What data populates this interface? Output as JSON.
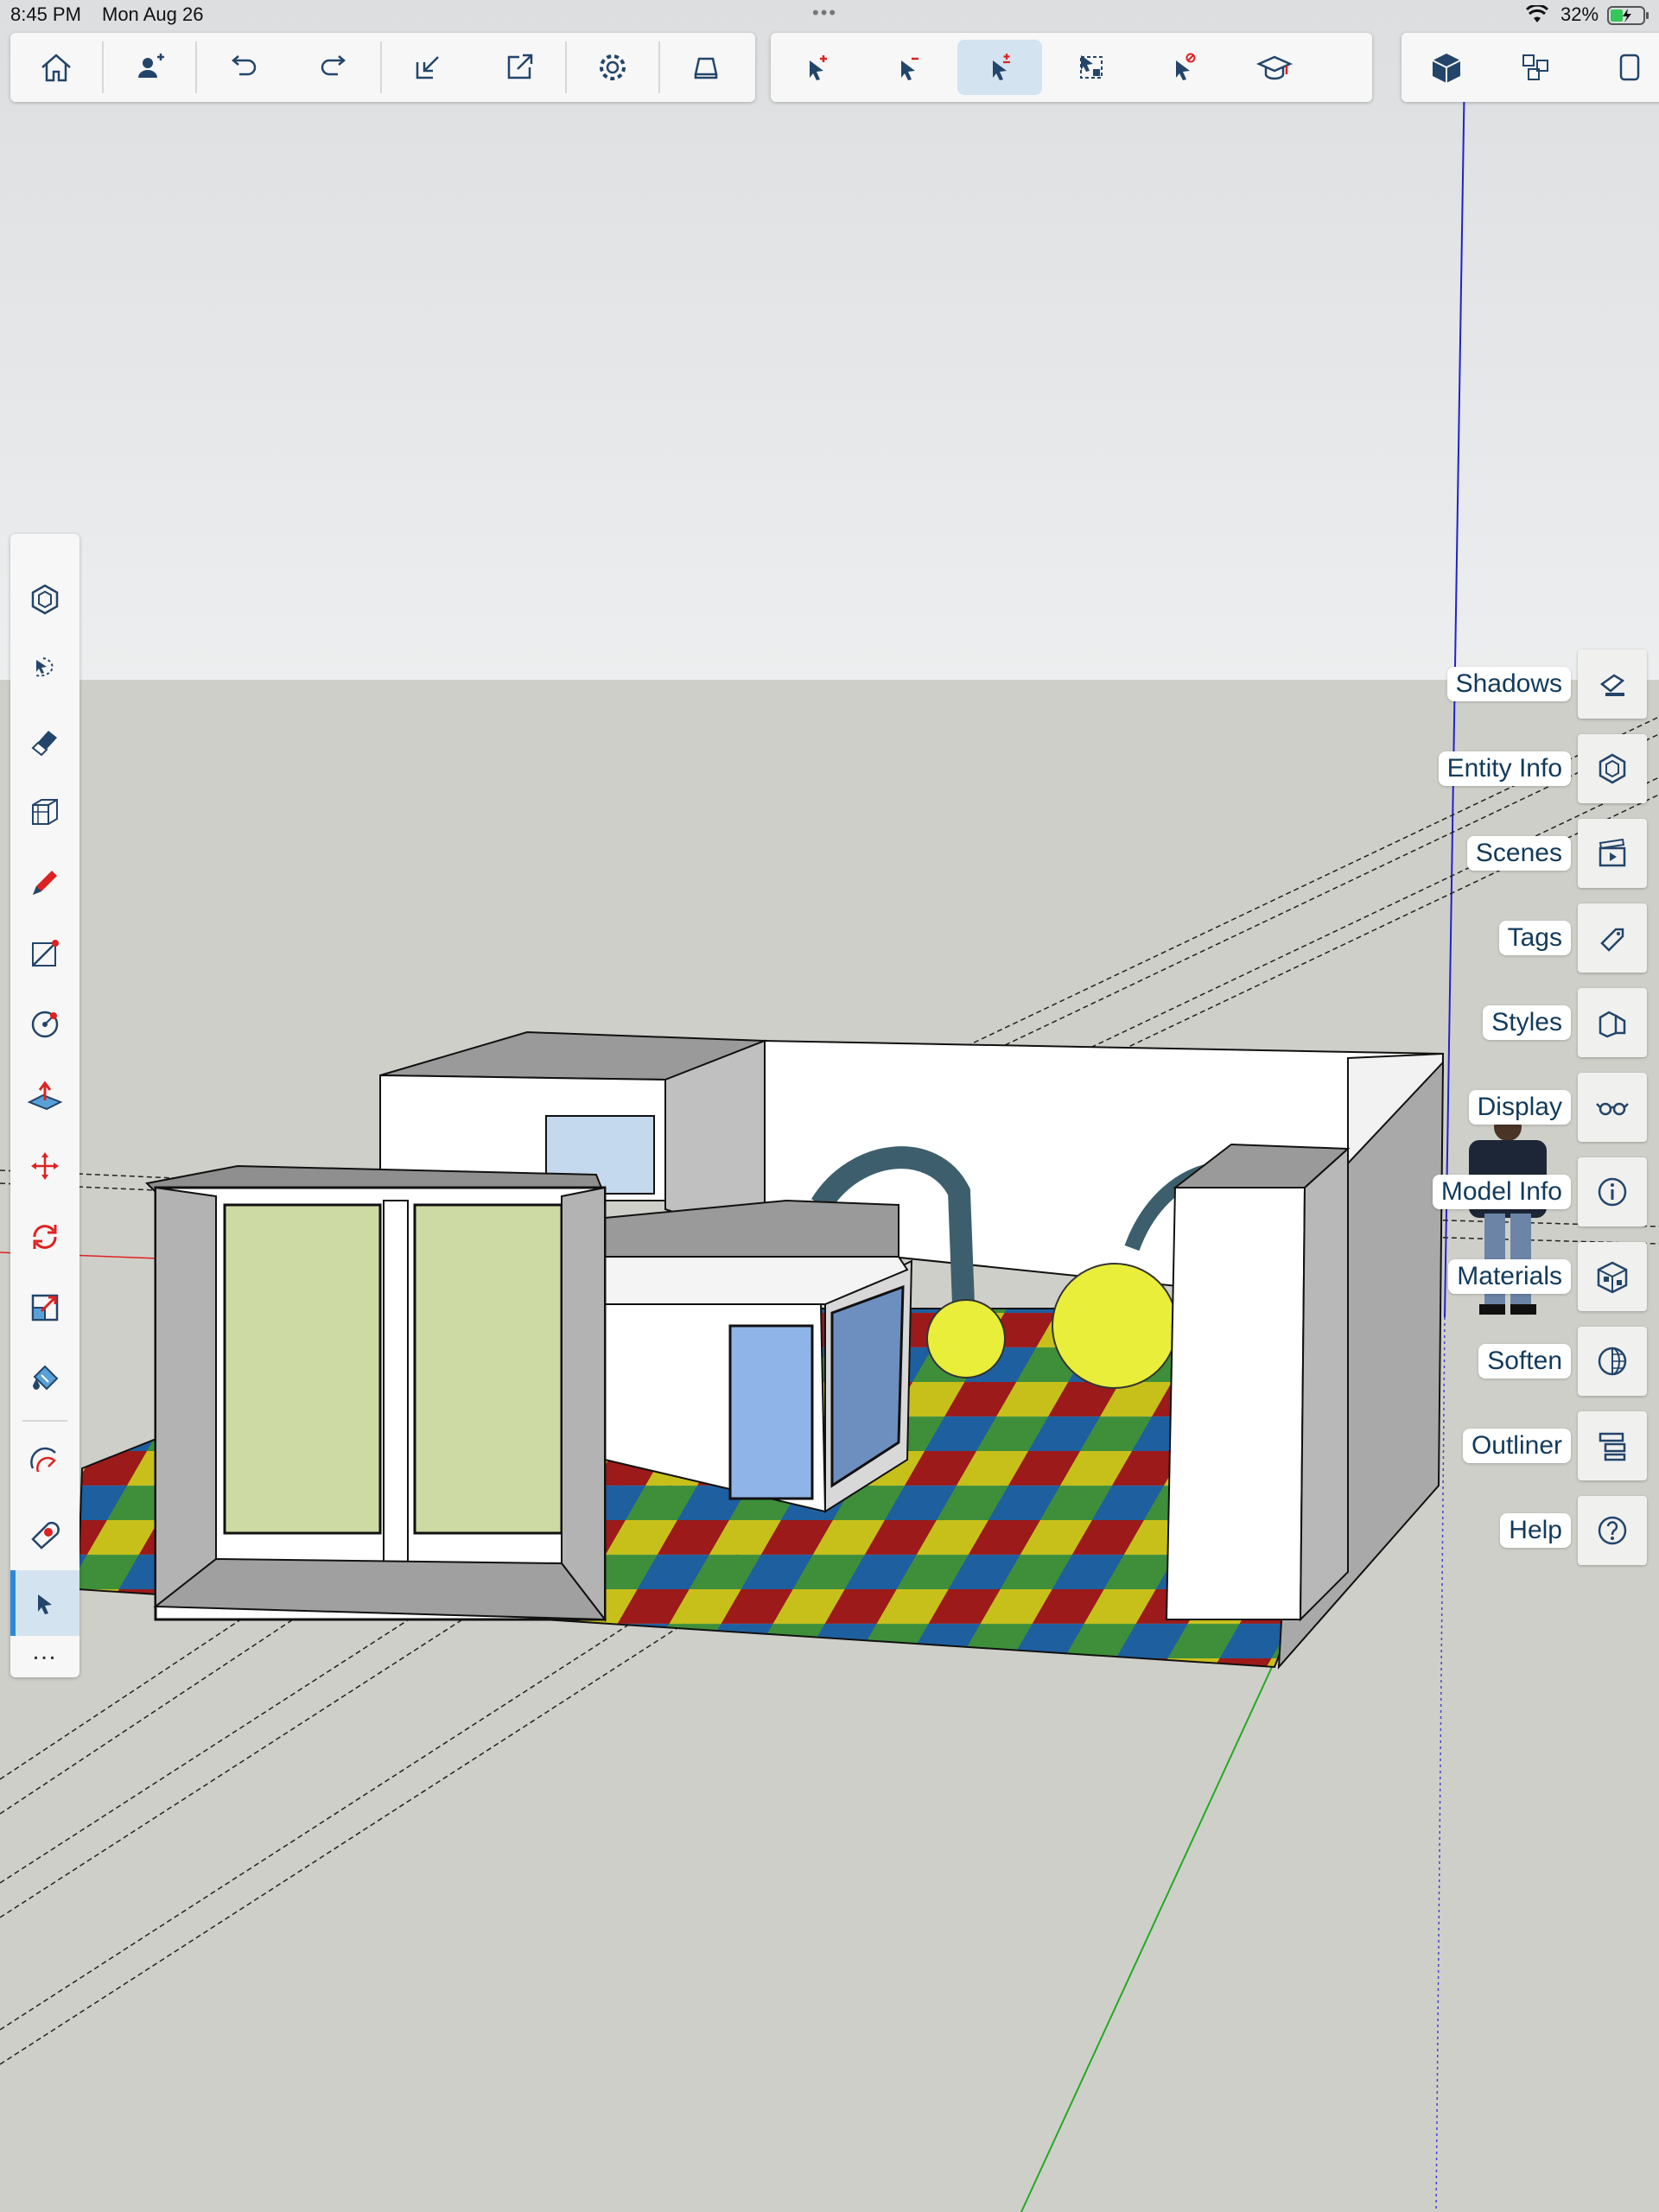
{
  "status_bar": {
    "time": "8:45 PM",
    "date": "Mon Aug 26",
    "multitask_dots": "•••",
    "battery_percent": "32%"
  },
  "top_toolbar": {
    "groups": [
      [
        "home-icon",
        "add-collaborator-icon",
        "undo-icon",
        "redo-icon",
        "import-icon",
        "export-icon",
        "settings-icon",
        "view-icon"
      ],
      [
        "select-add-icon",
        "select-subtract-icon",
        "select-toggle-icon",
        "select-grid-icon",
        "select-none-icon",
        "learn-icon"
      ],
      [
        "3d-warehouse-icon",
        "components-icon",
        "more-icon"
      ]
    ],
    "active_tool": "select-toggle-icon"
  },
  "left_toolbar": {
    "tools": [
      "orbit-icon",
      "lasso-select-icon",
      "eraser-icon",
      "box-icon",
      "pencil-icon",
      "line-icon",
      "circle-icon",
      "push-pull-icon",
      "move-icon",
      "rotate-icon",
      "scale-icon",
      "paint-icon",
      "offset-icon",
      "tape-measure-icon",
      "select-icon"
    ],
    "active_tool": "select-icon",
    "more_label": "…"
  },
  "right_panel": {
    "items": [
      {
        "label": "Shadows",
        "icon": "shadows-icon"
      },
      {
        "label": "Entity Info",
        "icon": "entity-info-icon"
      },
      {
        "label": "Scenes",
        "icon": "scenes-icon"
      },
      {
        "label": "Tags",
        "icon": "tags-icon"
      },
      {
        "label": "Styles",
        "icon": "styles-icon"
      },
      {
        "label": "Display",
        "icon": "display-icon"
      },
      {
        "label": "Model Info",
        "icon": "model-info-icon"
      },
      {
        "label": "Materials",
        "icon": "materials-icon"
      },
      {
        "label": "Soften",
        "icon": "soften-icon"
      },
      {
        "label": "Outliner",
        "icon": "outliner-icon"
      },
      {
        "label": "Help",
        "icon": "help-icon"
      }
    ]
  },
  "colors": {
    "icon": "#23456a",
    "accent": "#2b8ad8",
    "active_bg": "#d4e3f0",
    "label_text": "#123a5c",
    "axis_red": "#d22",
    "axis_green": "#2a2",
    "axis_blue": "#22c"
  }
}
